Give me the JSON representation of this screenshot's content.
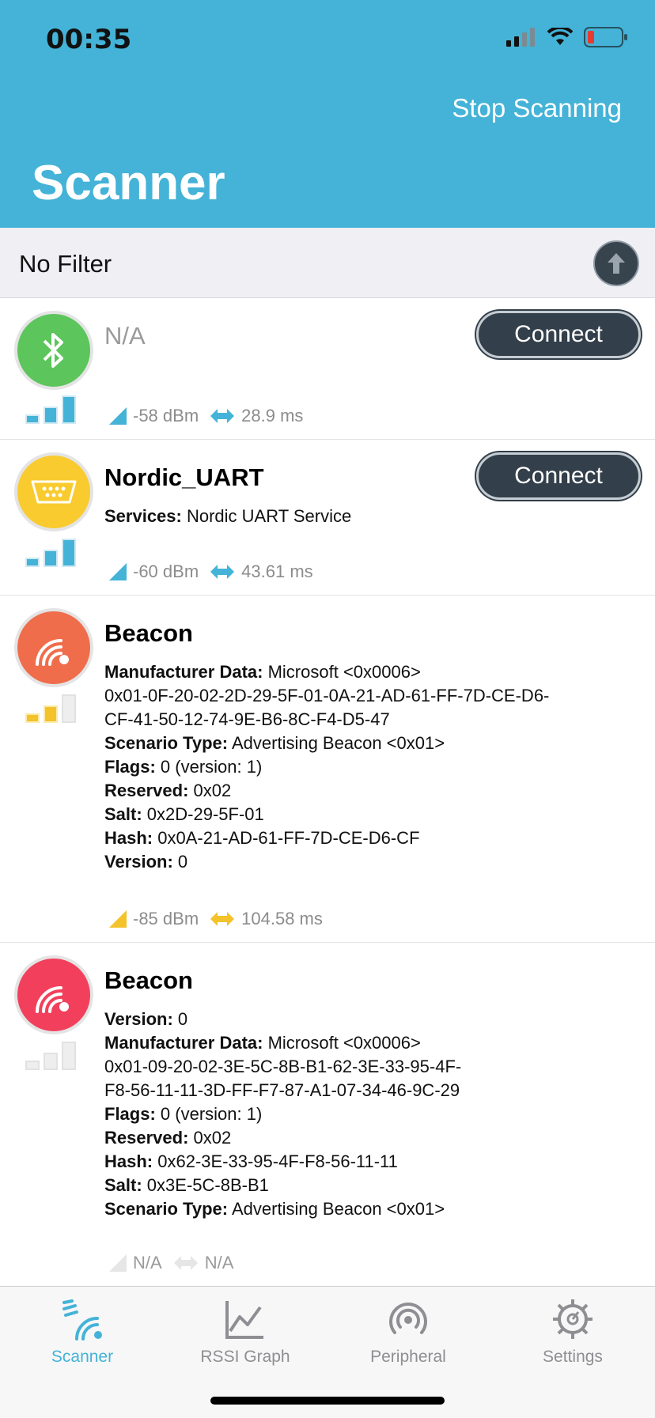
{
  "status_bar": {
    "time": "00:35"
  },
  "header": {
    "stop_label": "Stop Scanning",
    "title": "Scanner"
  },
  "filter": {
    "label": "No Filter"
  },
  "colors": {
    "accent": "#44b3d7",
    "connect_bg": "#333f4a"
  },
  "devices": [
    {
      "name": "N/A",
      "icon": "bluetooth-icon",
      "connect_label": "Connect",
      "rssi": "-58 dBm",
      "interval": "28.9 ms"
    },
    {
      "name": "Nordic_UART",
      "icon": "serial-port-icon",
      "connect_label": "Connect",
      "services_key": "Services:",
      "services_val": " Nordic UART Service",
      "rssi": "-60 dBm",
      "interval": "43.61 ms"
    },
    {
      "name": "Beacon",
      "icon": "beacon-icon",
      "lines": [
        {
          "k": "Manufacturer Data:",
          "v": " Microsoft <0x0006>"
        },
        {
          "k": "",
          "v": "0x01-0F-20-02-2D-29-5F-01-0A-21-AD-61-FF-7D-CE-D6-"
        },
        {
          "k": "",
          "v": "CF-41-50-12-74-9E-B6-8C-F4-D5-47"
        },
        {
          "k": "Scenario Type:",
          "v": " Advertising Beacon <0x01>"
        },
        {
          "k": "Flags:",
          "v": " 0 (version: 1)"
        },
        {
          "k": "Reserved:",
          "v": " 0x02"
        },
        {
          "k": "Salt:",
          "v": " 0x2D-29-5F-01"
        },
        {
          "k": "Hash:",
          "v": " 0x0A-21-AD-61-FF-7D-CE-D6-CF"
        },
        {
          "k": "Version:",
          "v": " 0"
        }
      ],
      "rssi": "-85 dBm",
      "interval": "104.58 ms"
    },
    {
      "name": "Beacon",
      "icon": "beacon-icon",
      "lines": [
        {
          "k": "Version:",
          "v": " 0"
        },
        {
          "k": "Manufacturer Data:",
          "v": " Microsoft <0x0006>"
        },
        {
          "k": "",
          "v": "0x01-09-20-02-3E-5C-8B-B1-62-3E-33-95-4F-"
        },
        {
          "k": "",
          "v": "F8-56-11-11-3D-FF-F7-87-A1-07-34-46-9C-29"
        },
        {
          "k": "Flags:",
          "v": " 0 (version: 1)"
        },
        {
          "k": "Reserved:",
          "v": " 0x02"
        },
        {
          "k": "Hash:",
          "v": " 0x62-3E-33-95-4F-F8-56-11-11"
        },
        {
          "k": "Salt:",
          "v": " 0x3E-5C-8B-B1"
        },
        {
          "k": "Scenario Type:",
          "v": " Advertising Beacon <0x01>"
        }
      ],
      "rssi": "N/A",
      "interval": "N/A"
    }
  ],
  "tabs": [
    {
      "label": "Scanner",
      "icon": "scanner-icon"
    },
    {
      "label": "RSSI Graph",
      "icon": "graph-icon"
    },
    {
      "label": "Peripheral",
      "icon": "peripheral-icon"
    },
    {
      "label": "Settings",
      "icon": "gear-icon"
    }
  ]
}
